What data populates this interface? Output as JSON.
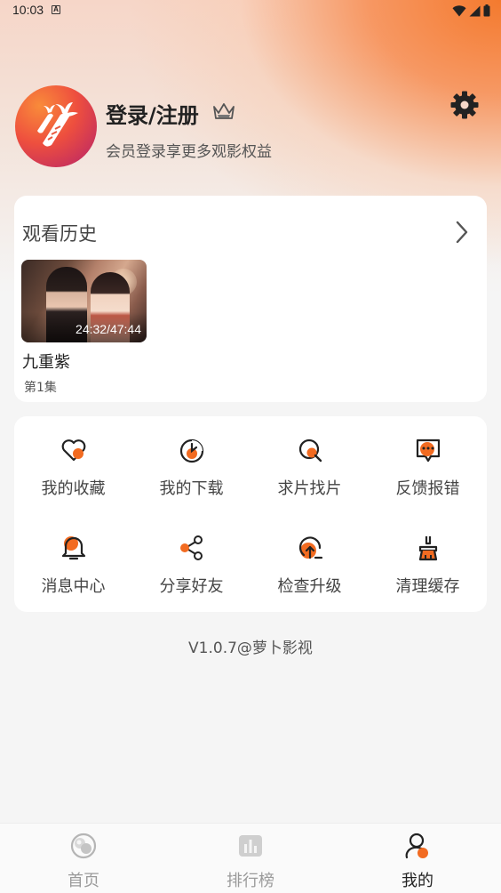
{
  "status_bar": {
    "time": "10:03",
    "notification_icon": "a-icon"
  },
  "profile": {
    "title": "登录/注册",
    "subtitle": "会员登录享更多观影权益",
    "avatar_icon": "carrot-logo-icon",
    "crown_icon": "crown-icon",
    "settings_icon": "gear-icon"
  },
  "history": {
    "title": "观看历史",
    "items": [
      {
        "title": "九重紫",
        "episode": "第1集",
        "duration": "24:32/47:44"
      }
    ]
  },
  "menu": {
    "items": [
      {
        "label": "我的收藏",
        "icon": "heart-icon"
      },
      {
        "label": "我的下载",
        "icon": "download-icon"
      },
      {
        "label": "求片找片",
        "icon": "search-icon"
      },
      {
        "label": "反馈报错",
        "icon": "feedback-icon"
      },
      {
        "label": "消息中心",
        "icon": "bell-icon"
      },
      {
        "label": "分享好友",
        "icon": "share-icon"
      },
      {
        "label": "检查升级",
        "icon": "upgrade-icon"
      },
      {
        "label": "清理缓存",
        "icon": "broom-icon"
      }
    ]
  },
  "version": "V1.0.7@萝卜影视",
  "nav": {
    "items": [
      {
        "label": "首页",
        "icon": "home-icon",
        "active": false
      },
      {
        "label": "排行榜",
        "icon": "ranking-icon",
        "active": false
      },
      {
        "label": "我的",
        "icon": "profile-icon",
        "active": true
      }
    ]
  },
  "colors": {
    "accent": "#f26b21",
    "active_nav": "#222222",
    "inactive_nav": "#9a9a9a"
  }
}
